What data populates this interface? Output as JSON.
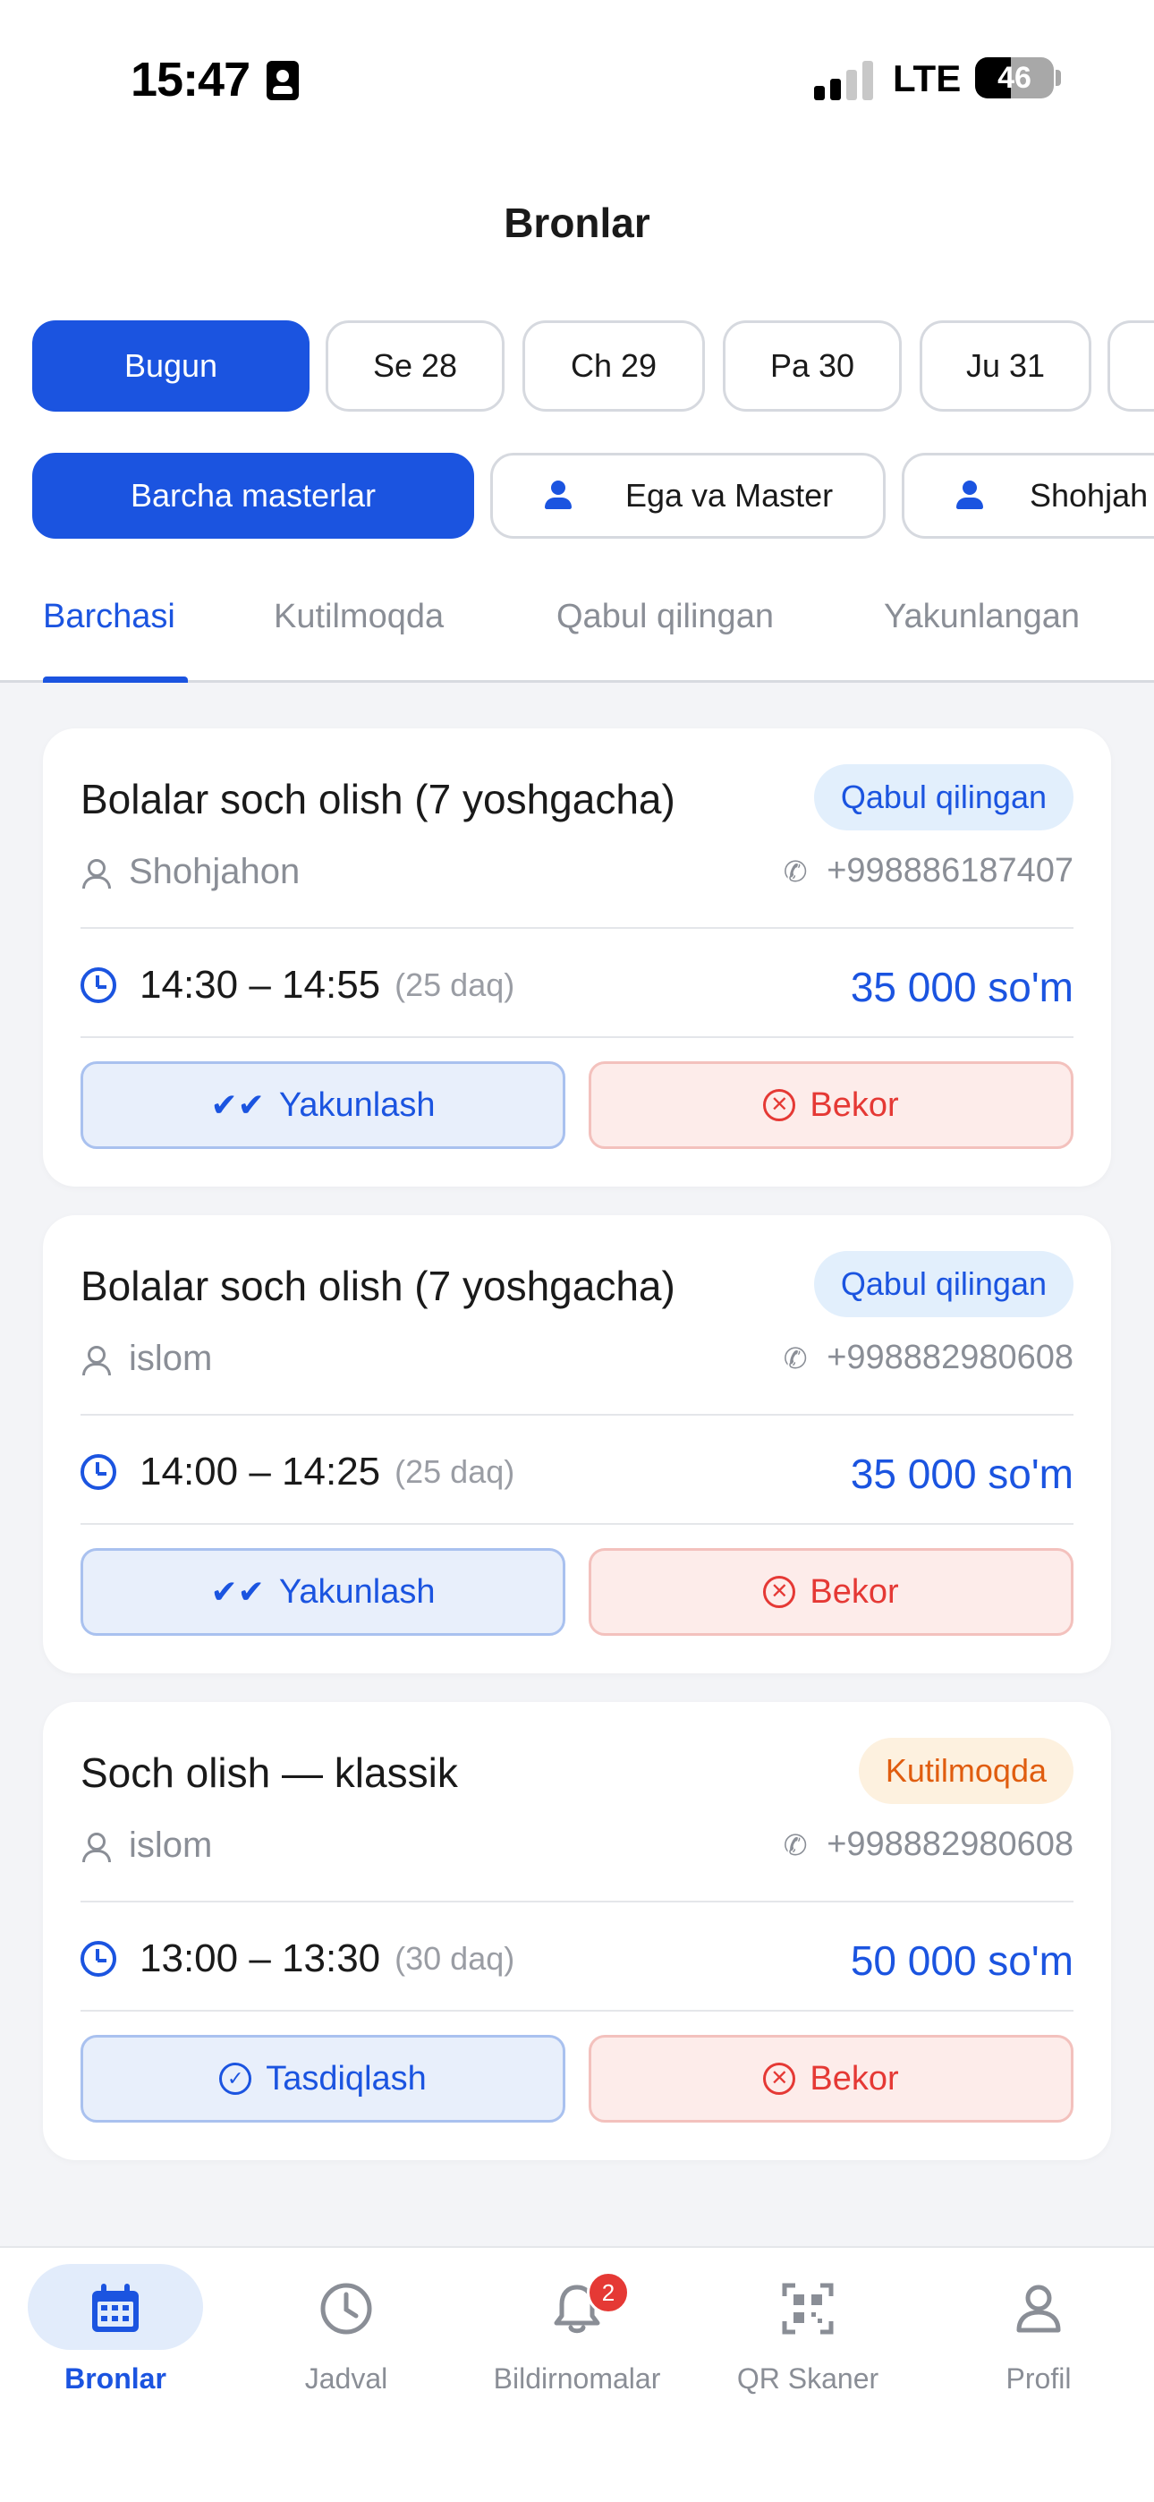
{
  "status_bar": {
    "time": "15:47",
    "network": "LTE",
    "battery": "46"
  },
  "header": {
    "title": "Bronlar"
  },
  "date_chips": [
    {
      "label": "Bugun",
      "active": true
    },
    {
      "label": "Se 28",
      "active": false
    },
    {
      "label": "Ch 29",
      "active": false
    },
    {
      "label": "Pa 30",
      "active": false
    },
    {
      "label": "Ju 31",
      "active": false
    }
  ],
  "master_chips": [
    {
      "label": "Barcha masterlar",
      "active": true
    },
    {
      "label": "Ega va Master",
      "active": false
    },
    {
      "label": "Shohjah",
      "active": false
    }
  ],
  "tabs": [
    {
      "label": "Barchasi",
      "active": true
    },
    {
      "label": "Kutilmoqda",
      "active": false
    },
    {
      "label": "Qabul qilingan",
      "active": false
    },
    {
      "label": "Yakunlangan",
      "active": false
    }
  ],
  "bookings": [
    {
      "service": "Bolalar soch olish (7 yoshgacha)",
      "status": "Qabul qilingan",
      "client": "Shohjahon",
      "phone": "+998886187407",
      "time": "14:30 – 14:55",
      "duration": "(25 daq)",
      "price": "35 000 so'm",
      "primary_action": "Yakunlash",
      "cancel_action": "Bekor"
    },
    {
      "service": "Bolalar soch olish (7 yoshgacha)",
      "status": "Qabul qilingan",
      "client": "islom",
      "phone": "+998882980608",
      "time": "14:00 – 14:25",
      "duration": "(25 daq)",
      "price": "35 000 so'm",
      "primary_action": "Yakunlash",
      "cancel_action": "Bekor"
    },
    {
      "service": "Soch olish — klassik",
      "status": "Kutilmoqda",
      "client": "islom",
      "phone": "+998882980608",
      "time": "13:00 – 13:30",
      "duration": "(30 daq)",
      "price": "50 000 so'm",
      "primary_action": "Tasdiqlash",
      "cancel_action": "Bekor"
    }
  ],
  "bottom_nav": [
    {
      "label": "Bronlar",
      "icon": "calendar-icon",
      "active": true
    },
    {
      "label": "Jadval",
      "icon": "clock-icon",
      "active": false
    },
    {
      "label": "Bildirnomalar",
      "icon": "bell-icon",
      "active": false,
      "badge": "2"
    },
    {
      "label": "QR Skaner",
      "icon": "qr-icon",
      "active": false
    },
    {
      "label": "Profil",
      "icon": "person-icon",
      "active": false
    }
  ],
  "colors": {
    "accent": "#1b54e0",
    "danger": "#e53935",
    "pending": "#e05d0f"
  }
}
